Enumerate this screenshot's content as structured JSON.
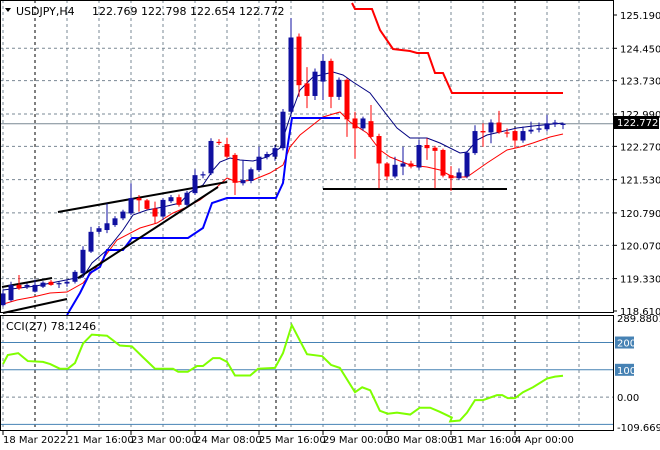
{
  "header": {
    "symbol": "USDJPY,H4",
    "ohlc": "122.769 122.798 122.654 122.772",
    "collapse_icon": "triangle-down-icon"
  },
  "current_price_label": "122.772",
  "colors": {
    "bull": "#1010a0",
    "bear": "#ff0000",
    "ma_fast": "#000080",
    "ma_slow": "#ff0000",
    "channel_low": "#0000ff",
    "channel_high": "#ff0000",
    "cci": "#7fff00",
    "cci_levels": "#4682b4",
    "price_tag_bg": "#000000"
  },
  "chart_data": [
    {
      "type": "candlestick",
      "title": "USDJPY,H4",
      "ylim": [
        118.61,
        125.19
      ],
      "y_ticks": [
        "125.190",
        "124.450",
        "123.730",
        "122.990",
        "122.270",
        "121.530",
        "120.790",
        "120.070",
        "119.330",
        "118.610"
      ],
      "x_ticks": [
        {
          "index": 0,
          "label": "18 Mar 2022"
        },
        {
          "index": 8,
          "label": "21 Mar 16:00"
        },
        {
          "index": 16,
          "label": "23 Mar 00:00"
        },
        {
          "index": 24,
          "label": "24 Mar 08:00"
        },
        {
          "index": 32,
          "label": "25 Mar 16:00"
        },
        {
          "index": 40,
          "label": "29 Mar 00:00"
        },
        {
          "index": 48,
          "label": "30 Mar 08:00"
        },
        {
          "index": 56,
          "label": "31 Mar 16:00"
        },
        {
          "index": 64,
          "label": "4 Apr 00:00"
        }
      ],
      "ohlc": [
        [
          118.74,
          119.08,
          118.71,
          119.0
        ],
        [
          118.85,
          119.26,
          118.82,
          119.19
        ],
        [
          119.19,
          119.41,
          119.08,
          119.11
        ],
        [
          119.15,
          119.22,
          119.1,
          119.19
        ],
        [
          119.04,
          119.31,
          119.02,
          119.19
        ],
        [
          119.15,
          119.27,
          119.12,
          119.24
        ],
        [
          119.26,
          119.3,
          119.17,
          119.19
        ],
        [
          119.22,
          119.26,
          119.12,
          119.23
        ],
        [
          119.22,
          119.3,
          119.15,
          119.26
        ],
        [
          119.26,
          119.52,
          119.22,
          119.48
        ],
        [
          119.45,
          120.05,
          119.4,
          119.97
        ],
        [
          119.93,
          120.48,
          119.9,
          120.37
        ],
        [
          120.37,
          120.5,
          120.32,
          120.45
        ],
        [
          120.41,
          121.0,
          120.34,
          120.56
        ],
        [
          120.52,
          120.72,
          120.48,
          120.67
        ],
        [
          120.67,
          120.86,
          120.63,
          120.82
        ],
        [
          120.78,
          121.45,
          120.74,
          121.12
        ],
        [
          121.12,
          121.19,
          120.82,
          121.07
        ],
        [
          121.07,
          121.1,
          120.86,
          120.88
        ],
        [
          120.89,
          121.04,
          120.56,
          120.71
        ],
        [
          120.71,
          121.12,
          120.63,
          121.08
        ],
        [
          121.05,
          121.19,
          121.01,
          121.14
        ],
        [
          121.14,
          121.2,
          120.93,
          120.97
        ],
        [
          120.97,
          121.28,
          120.93,
          121.24
        ],
        [
          121.23,
          121.76,
          121.19,
          121.63
        ],
        [
          121.63,
          121.71,
          121.56,
          121.65
        ],
        [
          121.67,
          122.45,
          121.63,
          122.39
        ],
        [
          122.37,
          122.43,
          122.3,
          122.35
        ],
        [
          122.32,
          122.46,
          122.0,
          122.04
        ],
        [
          122.08,
          122.12,
          121.19,
          121.46
        ],
        [
          121.45,
          121.97,
          121.4,
          121.52
        ],
        [
          121.5,
          121.8,
          121.45,
          121.76
        ],
        [
          121.74,
          122.26,
          121.7,
          122.04
        ],
        [
          122.03,
          122.15,
          121.98,
          122.1
        ],
        [
          122.04,
          122.3,
          121.95,
          122.23
        ],
        [
          122.23,
          123.1,
          122.18,
          123.04
        ],
        [
          123.04,
          125.12,
          122.95,
          124.69
        ],
        [
          124.71,
          124.78,
          123.37,
          123.63
        ],
        [
          123.67,
          124.03,
          123.12,
          123.39
        ],
        [
          123.39,
          124.0,
          123.3,
          123.93
        ],
        [
          123.71,
          124.32,
          123.3,
          124.17
        ],
        [
          124.17,
          124.22,
          123.12,
          123.37
        ],
        [
          123.37,
          123.8,
          123.3,
          123.75
        ],
        [
          123.75,
          123.78,
          122.48,
          122.87
        ],
        [
          122.89,
          123.04,
          122.0,
          122.67
        ],
        [
          122.67,
          122.93,
          122.62,
          122.89
        ],
        [
          122.83,
          123.19,
          122.45,
          122.48
        ],
        [
          122.5,
          122.55,
          121.34,
          121.89
        ],
        [
          121.89,
          121.92,
          121.52,
          121.6
        ],
        [
          121.6,
          122.04,
          121.56,
          121.86
        ],
        [
          121.82,
          122.26,
          121.63,
          121.89
        ],
        [
          121.89,
          121.95,
          121.78,
          121.82
        ],
        [
          121.8,
          122.41,
          121.75,
          122.3
        ],
        [
          122.3,
          122.45,
          121.97,
          122.23
        ],
        [
          122.24,
          122.28,
          121.34,
          122.17
        ],
        [
          122.19,
          122.22,
          121.58,
          121.62
        ],
        [
          121.63,
          121.83,
          121.28,
          121.56
        ],
        [
          121.56,
          121.78,
          121.52,
          121.69
        ],
        [
          121.6,
          122.17,
          121.56,
          122.13
        ],
        [
          122.12,
          122.74,
          122.08,
          122.61
        ],
        [
          122.61,
          122.78,
          122.26,
          122.58
        ],
        [
          122.58,
          122.87,
          122.34,
          122.8
        ],
        [
          122.8,
          123.06,
          122.55,
          122.58
        ],
        [
          122.58,
          122.67,
          122.47,
          122.56
        ],
        [
          122.61,
          122.65,
          122.23,
          122.4
        ],
        [
          122.4,
          122.71,
          122.35,
          122.61
        ],
        [
          122.6,
          122.82,
          122.55,
          122.64
        ],
        [
          122.64,
          122.8,
          122.58,
          122.67
        ],
        [
          122.65,
          122.97,
          122.6,
          122.78
        ],
        [
          122.76,
          122.86,
          122.7,
          122.8
        ],
        [
          122.769,
          122.798,
          122.654,
          122.772
        ]
      ],
      "current_price": 122.772
    },
    {
      "type": "line",
      "title": "CCI(27) 78.1246",
      "ylim": [
        -109.6698,
        289.8801
      ],
      "y_ticks": [
        "289.8801",
        "200",
        "100",
        "0.00",
        "-109.6698"
      ],
      "levels": [
        200,
        100,
        -100
      ],
      "points": [
        [
          0,
          121
        ],
        [
          0.6,
          154
        ],
        [
          1.9,
          161
        ],
        [
          3.1,
          132
        ],
        [
          5,
          129
        ],
        [
          5.9,
          121
        ],
        [
          7.1,
          104
        ],
        [
          8.1,
          104
        ],
        [
          9,
          125
        ],
        [
          10,
          196
        ],
        [
          11.1,
          229
        ],
        [
          13,
          225
        ],
        [
          14.6,
          189
        ],
        [
          16.1,
          186
        ],
        [
          17.5,
          146
        ],
        [
          19,
          104
        ],
        [
          21.25,
          104
        ],
        [
          21.9,
          93
        ],
        [
          23.1,
          93
        ],
        [
          24.25,
          114
        ],
        [
          25,
          114
        ],
        [
          26.25,
          143
        ],
        [
          27.1,
          143
        ],
        [
          28,
          129
        ],
        [
          29,
          79
        ],
        [
          30.9,
          79
        ],
        [
          31.9,
          104
        ],
        [
          34,
          107
        ],
        [
          35,
          161
        ],
        [
          36.1,
          264
        ],
        [
          38,
          157
        ],
        [
          39.9,
          150
        ],
        [
          41,
          118
        ],
        [
          42.1,
          107
        ],
        [
          44,
          18
        ],
        [
          44.9,
          36
        ],
        [
          45.9,
          25
        ],
        [
          47.1,
          -50
        ],
        [
          48.1,
          -61
        ],
        [
          49.25,
          -57
        ],
        [
          50.9,
          -64
        ],
        [
          52.1,
          -39
        ],
        [
          53.4,
          -39
        ],
        [
          54.6,
          -54
        ],
        [
          56.1,
          -75
        ],
        [
          55.9,
          -89
        ],
        [
          57.1,
          -86
        ],
        [
          58,
          -57
        ],
        [
          59,
          -11
        ],
        [
          60,
          -11
        ],
        [
          61.75,
          7
        ],
        [
          62.4,
          7
        ],
        [
          63.1,
          -4
        ],
        [
          64,
          -4
        ],
        [
          65,
          18
        ],
        [
          66.25,
          36
        ],
        [
          68,
          68
        ],
        [
          69,
          75
        ],
        [
          70,
          78.1246
        ]
      ]
    }
  ]
}
